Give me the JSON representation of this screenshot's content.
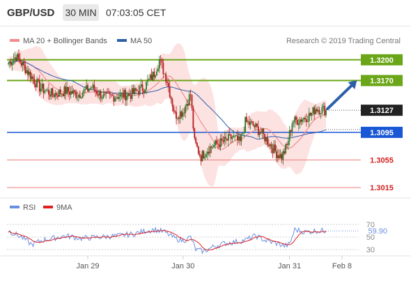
{
  "header": {
    "symbol": "GBP/USD",
    "timeframe": "30 MIN",
    "time": "07:03:05 CET"
  },
  "colors": {
    "up_candle": "#2a7a2a",
    "down_candle": "#b71c1c",
    "ma20": "#f28b8b",
    "bands_fill": "#fde2e2",
    "ma50": "#2c5fa8",
    "green_level": "#6aa617",
    "blue_level": "#1a57d6",
    "red_level": "#f07a7a",
    "current_tag": "#222222",
    "rsi": "#6a8fe0",
    "rsi_ma": "#e02020",
    "arrow": "#2c5fa8"
  },
  "chart_data": [
    {
      "type": "candlestick",
      "legend": [
        {
          "name": "MA 20 + Bollinger Bands",
          "color": "#f28b8b"
        },
        {
          "name": "MA 50",
          "color": "#2c5fa8"
        }
      ],
      "watermark": "Research © 2019 Trading Central",
      "ylim": [
        1.2995,
        1.3225
      ],
      "x_ticks": [
        {
          "label": "Jan 29",
          "frac": 0.25
        },
        {
          "label": "Jan 30",
          "frac": 0.55
        },
        {
          "label": "Jan 31",
          "frac": 0.885
        },
        {
          "label": "Feb 8",
          "frac": 1.0
        }
      ],
      "key_levels": [
        {
          "label": "1.3200",
          "value": 1.32,
          "style": "green-tag"
        },
        {
          "label": "1.3170",
          "value": 1.317,
          "style": "green-tag"
        },
        {
          "label": "1.3127",
          "value": 1.3127,
          "style": "current-tag"
        },
        {
          "label": "1.3095",
          "value": 1.3095,
          "style": "blue-tag"
        },
        {
          "label": "1.3055",
          "value": 1.3055,
          "style": "red-text"
        },
        {
          "label": "1.3015",
          "value": 1.3015,
          "style": "red-text"
        }
      ],
      "anchor_points": [
        [
          0,
          1.3195
        ],
        [
          6,
          1.3205
        ],
        [
          14,
          1.3185
        ],
        [
          24,
          1.316
        ],
        [
          34,
          1.315
        ],
        [
          44,
          1.3155
        ],
        [
          54,
          1.315
        ],
        [
          64,
          1.316
        ],
        [
          74,
          1.3145
        ],
        [
          84,
          1.3148
        ],
        [
          94,
          1.315
        ],
        [
          104,
          1.316
        ],
        [
          112,
          1.318
        ],
        [
          116,
          1.32
        ],
        [
          122,
          1.317
        ],
        [
          128,
          1.312
        ],
        [
          134,
          1.3125
        ],
        [
          140,
          1.315
        ],
        [
          143,
          1.308
        ],
        [
          148,
          1.306
        ],
        [
          154,
          1.3072
        ],
        [
          160,
          1.3078
        ],
        [
          166,
          1.3082
        ],
        [
          172,
          1.3088
        ],
        [
          178,
          1.308
        ],
        [
          182,
          1.311
        ],
        [
          188,
          1.3105
        ],
        [
          194,
          1.3095
        ],
        [
          200,
          1.308
        ],
        [
          206,
          1.3065
        ],
        [
          210,
          1.306
        ],
        [
          214,
          1.3075
        ],
        [
          218,
          1.311
        ],
        [
          226,
          1.3115
        ],
        [
          232,
          1.312
        ],
        [
          236,
          1.313
        ],
        [
          244,
          1.3127
        ]
      ],
      "candle_count": 245
    },
    {
      "type": "line",
      "legend": [
        {
          "name": "RSI",
          "color": "#6a8fe0"
        },
        {
          "name": "9MA",
          "color": "#e02020"
        }
      ],
      "ylim": [
        20,
        78
      ],
      "y_ticks": [
        70,
        50,
        30
      ],
      "current_value_label": "59.90",
      "rsi_anchor_points": [
        [
          0,
          60
        ],
        [
          10,
          50
        ],
        [
          18,
          38
        ],
        [
          26,
          45
        ],
        [
          34,
          48
        ],
        [
          44,
          52
        ],
        [
          56,
          48
        ],
        [
          70,
          50
        ],
        [
          84,
          52
        ],
        [
          96,
          55
        ],
        [
          106,
          60
        ],
        [
          112,
          62
        ],
        [
          120,
          58
        ],
        [
          128,
          48
        ],
        [
          134,
          44
        ],
        [
          140,
          50
        ],
        [
          144,
          30
        ],
        [
          150,
          27
        ],
        [
          158,
          35
        ],
        [
          166,
          40
        ],
        [
          174,
          42
        ],
        [
          182,
          45
        ],
        [
          190,
          52
        ],
        [
          198,
          44
        ],
        [
          206,
          40
        ],
        [
          212,
          36
        ],
        [
          216,
          38
        ],
        [
          220,
          62
        ],
        [
          228,
          58
        ],
        [
          236,
          60
        ],
        [
          244,
          60
        ]
      ]
    }
  ]
}
